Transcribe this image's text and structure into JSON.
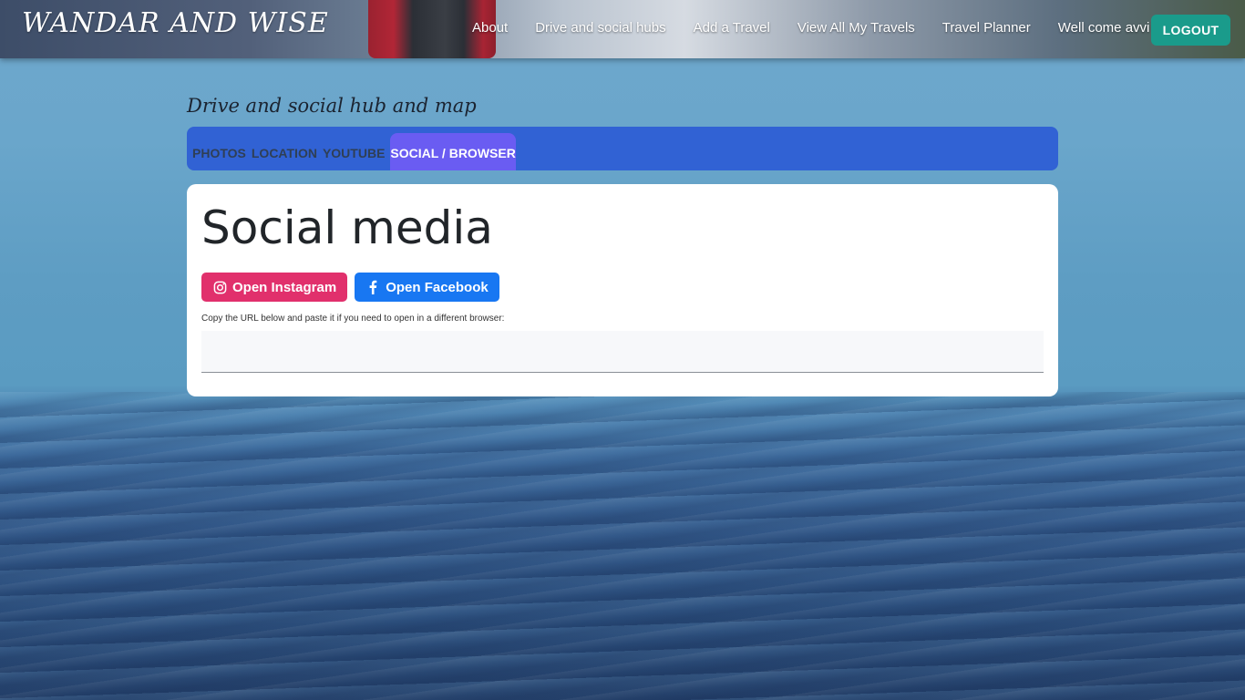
{
  "header": {
    "brand": "WANDAR AND WISE",
    "nav": [
      "About",
      "Drive and social hubs",
      "Add a Travel",
      "View All My Travels",
      "Travel Planner"
    ],
    "welcome": "Well come avvi",
    "logout_label": "LOGOUT"
  },
  "hub": {
    "title": "Drive and social hub and map",
    "tabs": [
      "PHOTOS",
      "LOCATION",
      "YOUTUBE",
      "SOCIAL / BROWSER"
    ],
    "active_tab": "SOCIAL / BROWSER"
  },
  "social": {
    "heading": "Social media",
    "instagram_label": "Open Instagram",
    "facebook_label": "Open Facebook",
    "hint": "Copy the URL below and paste it if you need to open in a different browser:",
    "url_value": ""
  },
  "colors": {
    "logout": "#1a9b8b",
    "tabbar": "#3162d4",
    "active_tab": "#6a5cf2",
    "instagram": "#e1306c",
    "facebook": "#1877f2"
  },
  "icons": {
    "instagram": "instagram-icon",
    "facebook": "facebook-icon"
  }
}
